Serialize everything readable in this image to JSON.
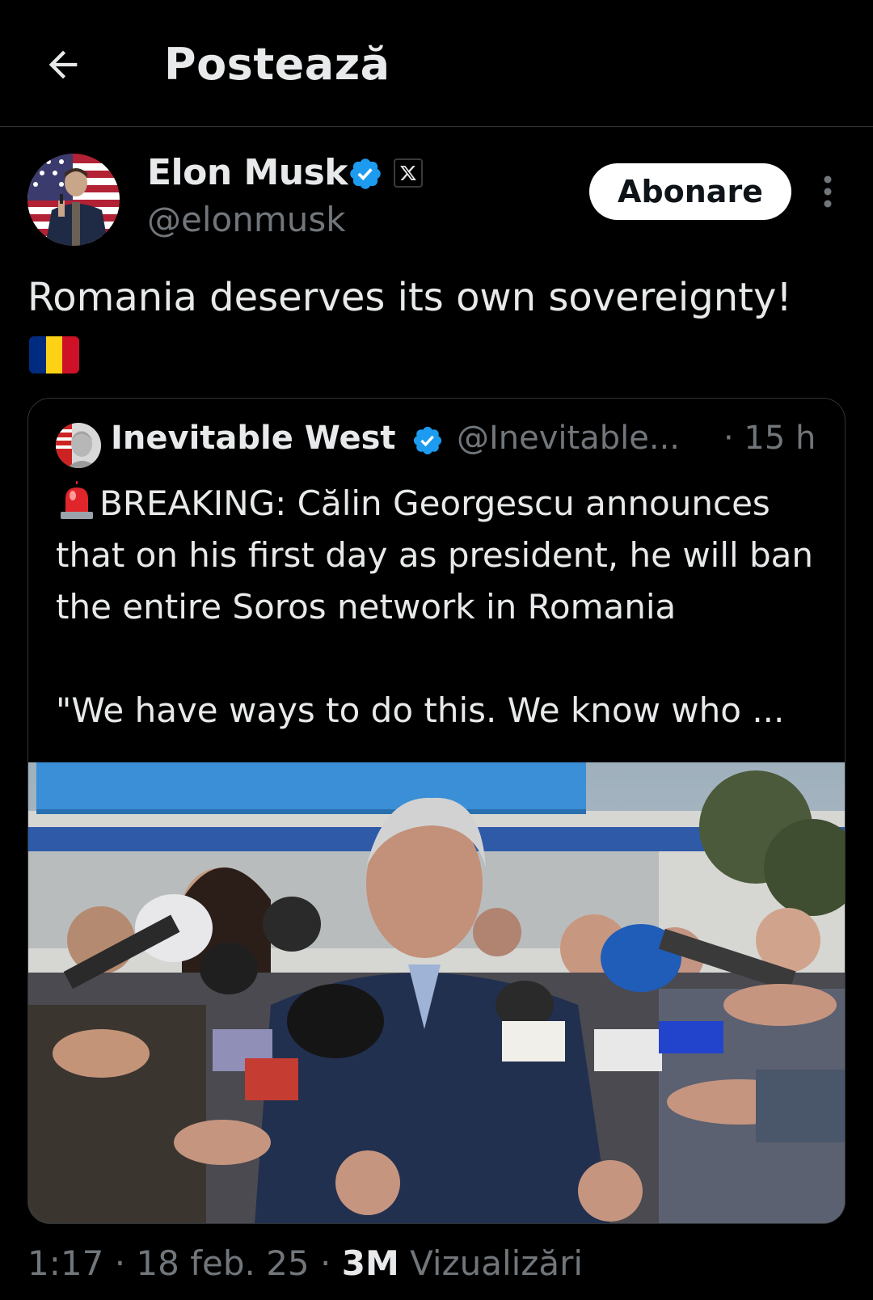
{
  "header": {
    "title": "Postează",
    "back_icon": "arrow-left-icon"
  },
  "post": {
    "author": {
      "name": "Elon Musk",
      "handle": "@elonmusk",
      "verified_color": "#1d9bf0"
    },
    "subscribe_label": "Abonare",
    "text": "Romania deserves its own sovereignty!",
    "flag_emoji": "romania-flag-icon",
    "quote": {
      "name": "Inevitable West",
      "handle": "@Inevitable...",
      "time": "· 15 h",
      "headline": "BREAKING: Călin Georgescu announces that on his first day as president, he will ban the entire Soros network in Romania",
      "snippet": "\"We have ways to do this. We know who ...",
      "siren_icon": "police-siren-icon"
    },
    "meta": {
      "time": "1:17",
      "separator1": "·",
      "date": "18 feb. 25",
      "separator2": "·",
      "views_count": "3M",
      "views_label": "Vizualizări"
    }
  },
  "colors": {
    "background": "#000000",
    "text_primary": "#e7e9ea",
    "text_secondary": "#71767b",
    "accent": "#1d9bf0",
    "border": "#2f3336"
  }
}
